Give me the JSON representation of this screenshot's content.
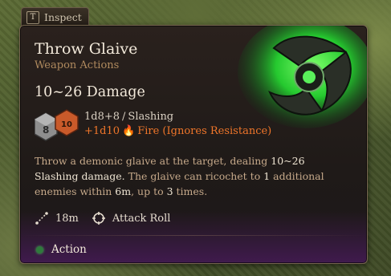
{
  "tab": {
    "key": "T",
    "label": "Inspect"
  },
  "tooltip": {
    "title": "Throw Glaive",
    "subtitle": "Weapon Actions",
    "damage_total": "10~26 Damage",
    "dice": {
      "d8": "8",
      "d10": "10"
    },
    "damage_lines": [
      {
        "dice": "1d8+8",
        "type": "Slashing",
        "icon": "slashing-icon"
      },
      {
        "dice": "+1d10",
        "type": "Fire (Ignores Resistance)",
        "icon": "fire-icon"
      }
    ],
    "description": {
      "p1": "Throw a demonic glaive at the target, dealing ",
      "range": "10~26",
      "p2": " Slashing damage.",
      "p3": " The glaive can ricochet to ",
      "count": "1",
      "p4": " additional enemies within ",
      "dist": "6m",
      "p5": ", up to ",
      "times": "3",
      "p6": " times."
    },
    "properties": [
      {
        "icon": "range-icon",
        "label": "18m"
      },
      {
        "icon": "crosshair-icon",
        "label": "Attack Roll"
      }
    ],
    "cost": {
      "label": "Action",
      "color": "#2f7a3c"
    }
  },
  "colors": {
    "fire": "#f0762a",
    "subtitle": "#b08a5e",
    "accent_green": "#3ae04a"
  }
}
